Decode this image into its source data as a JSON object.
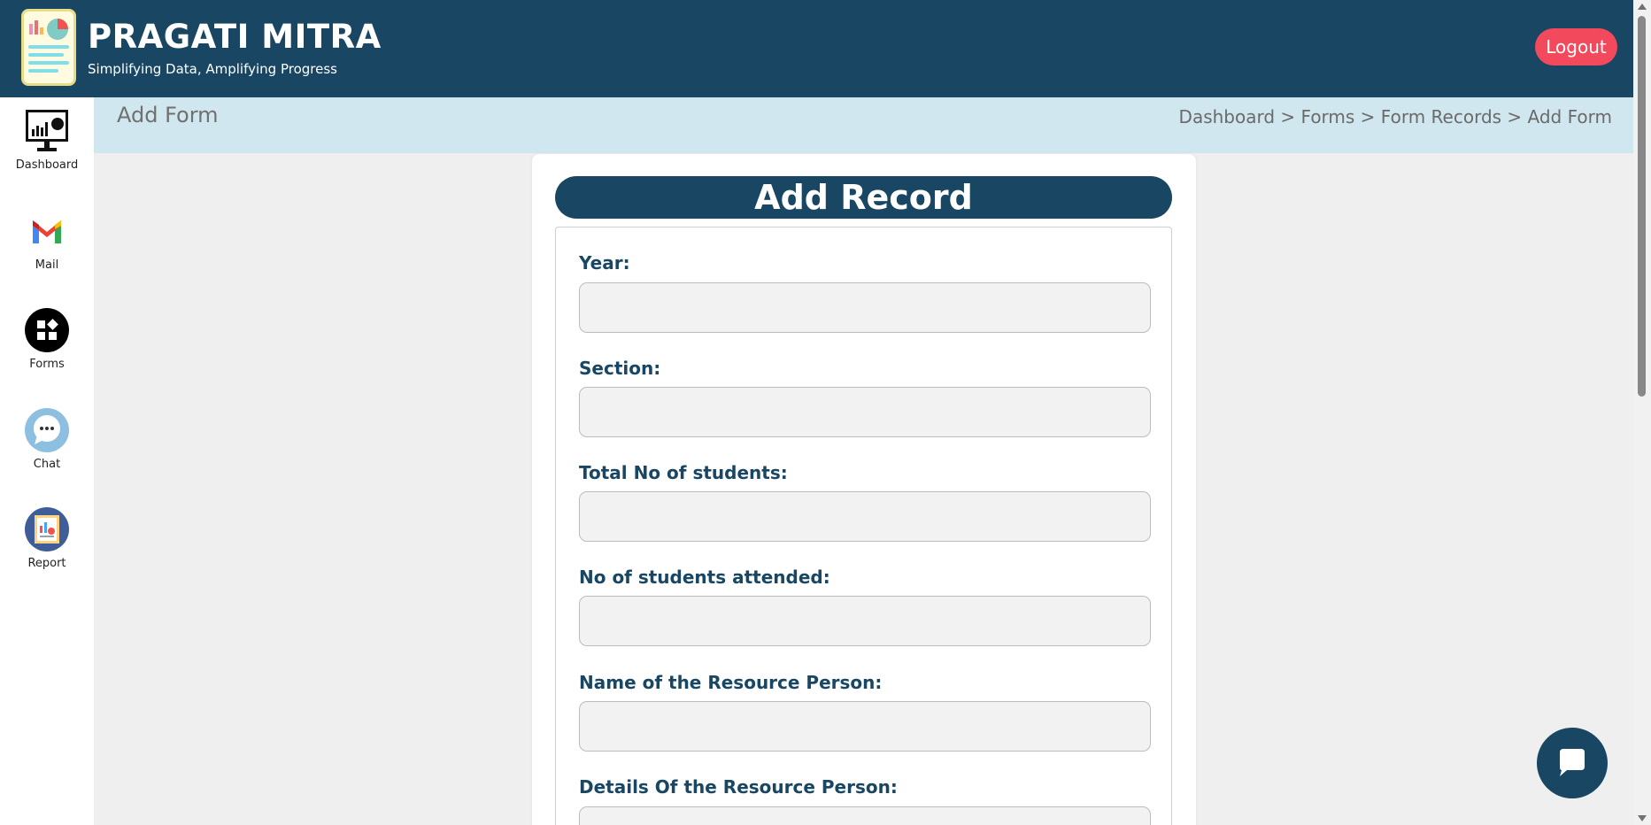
{
  "header": {
    "brand_title": "PRAGATI MITRA",
    "brand_subtitle": "Simplifying Data, Amplifying Progress",
    "logout_label": "Logout"
  },
  "sidebar": {
    "items": [
      {
        "label": "Dashboard",
        "icon": "dashboard-monitor-icon"
      },
      {
        "label": "Mail",
        "icon": "mail-icon"
      },
      {
        "label": "Forms",
        "icon": "forms-icon"
      },
      {
        "label": "Chat",
        "icon": "chat-icon"
      },
      {
        "label": "Report",
        "icon": "report-icon"
      }
    ]
  },
  "page": {
    "title": "Add Form",
    "breadcrumb": "Dashboard > Forms > Form Records > Add Form"
  },
  "form": {
    "heading": "Add Record",
    "fields": [
      {
        "label": "Year:",
        "value": ""
      },
      {
        "label": "Section:",
        "value": ""
      },
      {
        "label": "Total No of students:",
        "value": ""
      },
      {
        "label": "No of students attended:",
        "value": ""
      },
      {
        "label": "Name of the Resource Person:",
        "value": ""
      },
      {
        "label": "Details Of the Resource Person:",
        "value": ""
      }
    ]
  },
  "colors": {
    "primary": "#184663",
    "logout": "#f24a5c",
    "titlebar": "#d0e7ef"
  }
}
